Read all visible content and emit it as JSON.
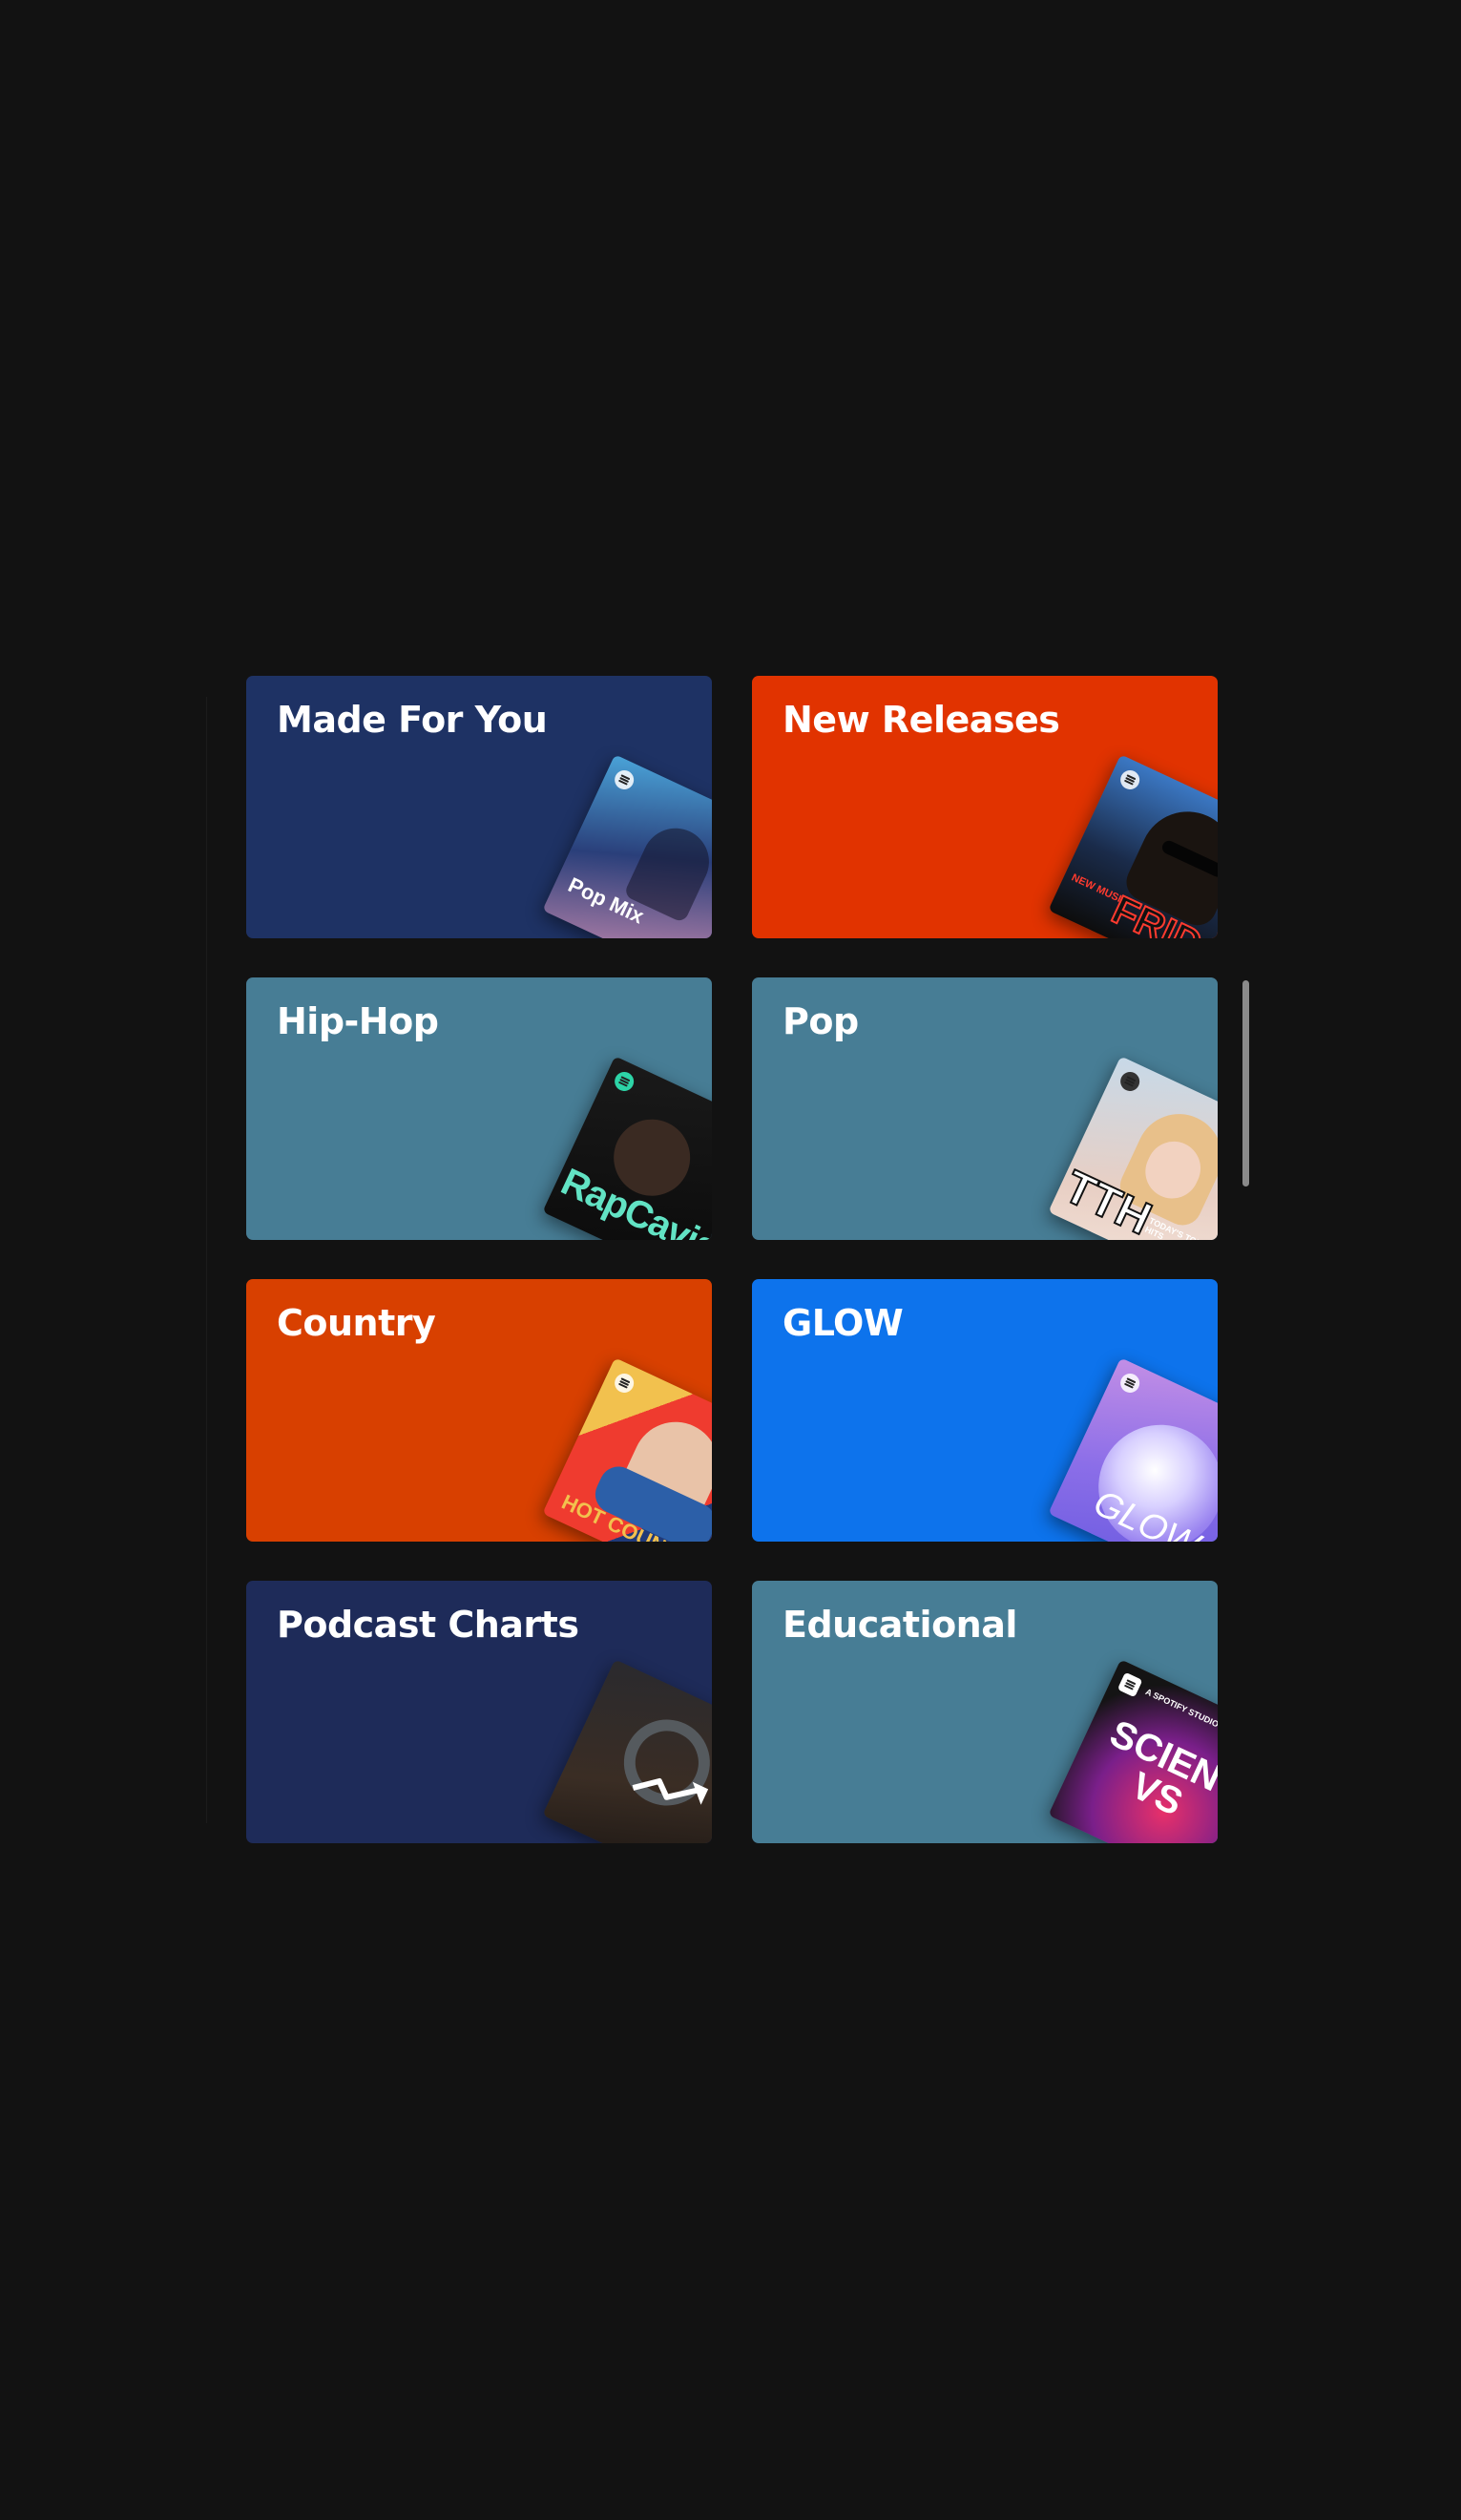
{
  "categories": [
    {
      "title": "Made For You",
      "bg": "#1e3264",
      "art_label": "Pop Mix",
      "icon": "pop-mix-cover"
    },
    {
      "title": "New Releases",
      "bg": "#e13300",
      "art_label": "FRIDAY",
      "art_label_small": "NEW MUSIC",
      "icon": "new-music-friday-cover"
    },
    {
      "title": "Hip-Hop",
      "bg": "#477d95",
      "art_label": "RapCaviar",
      "icon": "rapcaviar-cover"
    },
    {
      "title": "Pop",
      "bg": "#477d95",
      "art_label": "TTH",
      "art_label_small": "TODAY'S TOP HITS",
      "icon": "todays-top-hits-cover"
    },
    {
      "title": "Country",
      "bg": "#d84000",
      "art_label": "HOT COUNTRY",
      "icon": "hot-country-cover"
    },
    {
      "title": "GLOW",
      "bg": "#0d73ec",
      "art_label": "GLOW",
      "icon": "glow-cover"
    },
    {
      "title": "Podcast Charts",
      "bg": "#1e2b59",
      "art_label": "",
      "icon": "podcast-charts-cover"
    },
    {
      "title": "Educational",
      "bg": "#477d95",
      "art_label": "SCIENCE VS",
      "art_label_small": "A SPOTIFY STUDIOS ORIGINAL",
      "icon": "science-vs-cover"
    }
  ]
}
